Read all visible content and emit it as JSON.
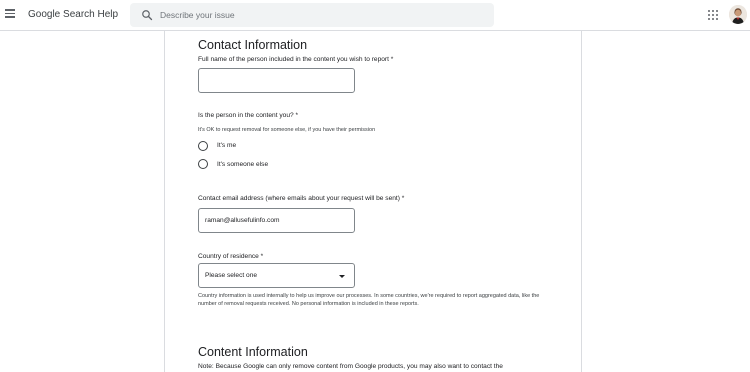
{
  "header": {
    "app_title": "Google Search Help",
    "search_placeholder": "Describe your issue",
    "icons": [
      "menu-icon",
      "search-icon",
      "apps-icon",
      "avatar"
    ]
  },
  "form": {
    "contact_title": "Contact Information",
    "full_name_label": "Full name of the person included in the content you wish to report *",
    "full_name_value": "",
    "person_question": "Is the person in the content you? *",
    "person_hint": "It's OK to request removal for someone else, if you have their permission",
    "radio_options": [
      "It's me",
      "It's someone else"
    ],
    "email_label": "Contact email address (where emails about your request will be sent) *",
    "email_value": "raman@allusefulinfo.com",
    "country_label": "Country of residence *",
    "country_value": "Please select one",
    "country_note": "Country information is used internally to help us improve our processes. In some countries, we're required to report aggregated data, like the number of removal requests received. No personal information is included in these reports.",
    "content_title": "Content Information",
    "content_note": "Note: Because Google can only remove content from Google products, you may also want to contact the"
  }
}
